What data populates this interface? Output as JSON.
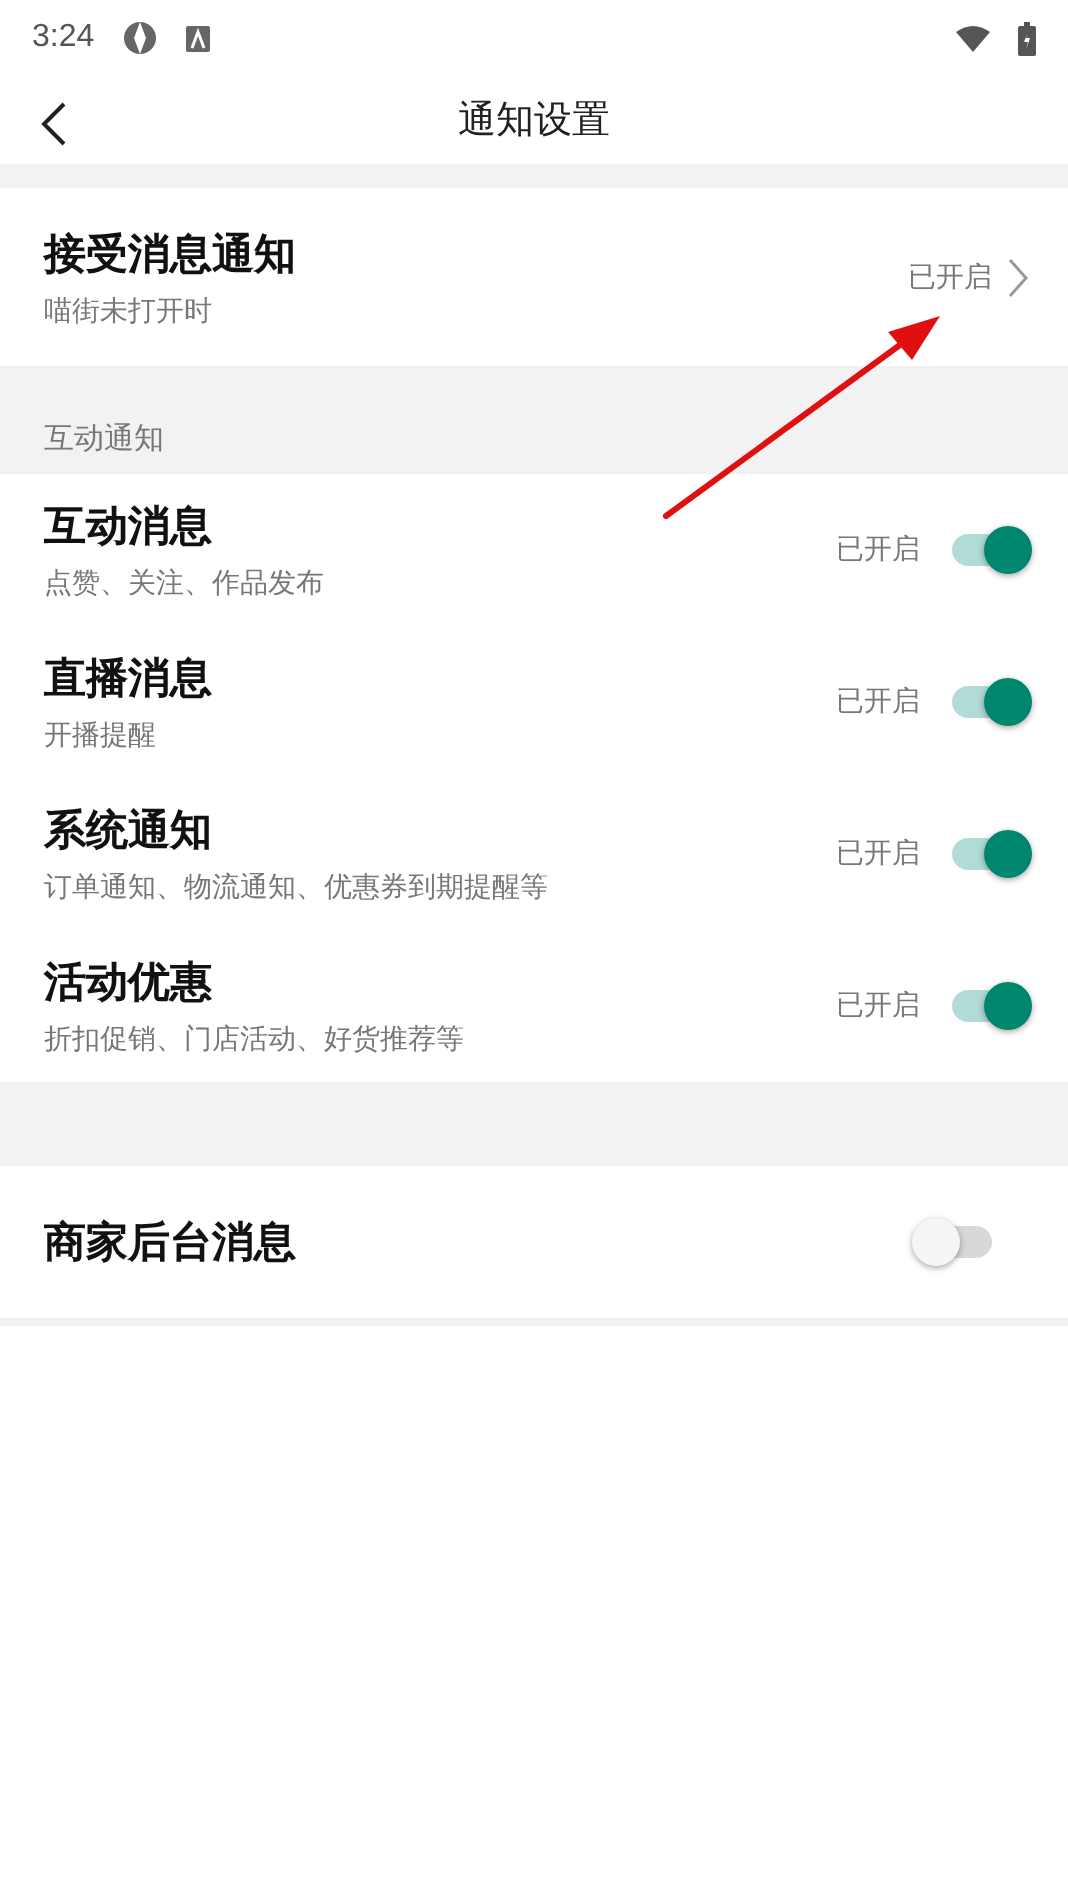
{
  "status_bar": {
    "time": "3:24"
  },
  "header": {
    "title": "通知设置"
  },
  "receive": {
    "title": "接受消息通知",
    "subtitle": "喵街未打开时",
    "status": "已开启"
  },
  "section": {
    "title": "互动通知",
    "items": [
      {
        "title": "互动消息",
        "subtitle": "点赞、关注、作品发布",
        "status": "已开启",
        "on": true
      },
      {
        "title": "直播消息",
        "subtitle": "开播提醒",
        "status": "已开启",
        "on": true
      },
      {
        "title": "系统通知",
        "subtitle": "订单通知、物流通知、优惠券到期提醒等",
        "status": "已开启",
        "on": true
      },
      {
        "title": "活动优惠",
        "subtitle": "折扣促销、门店活动、好货推荐等",
        "status": "已开启",
        "on": true
      }
    ]
  },
  "merchant": {
    "title": "商家后台消息",
    "on": false
  }
}
